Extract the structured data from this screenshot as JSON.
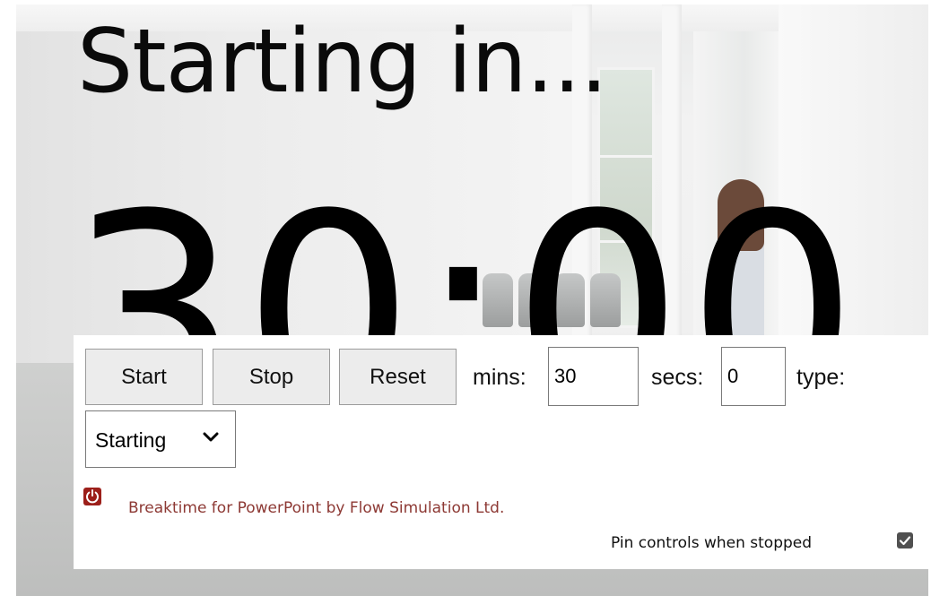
{
  "overlay": {
    "title": "Starting in...",
    "countdown": "30:00"
  },
  "controls": {
    "start_label": "Start",
    "stop_label": "Stop",
    "reset_label": "Reset",
    "mins_label": "mins:",
    "mins_value": "30",
    "secs_label": "secs:",
    "secs_value": "0",
    "type_label": "type:",
    "type_selected": "Starting"
  },
  "footer": {
    "credit_text": "Breaktime for PowerPoint by Flow Simulation Ltd.",
    "pin_label": "Pin controls when stopped",
    "pin_checked": true
  },
  "icons": {
    "logo": "power-icon",
    "dropdown": "chevron-down-icon",
    "check": "checkmark-icon"
  },
  "colors": {
    "credit_text": "#8d3934",
    "logo_bg": "#9c1f1a",
    "button_bg": "#ececec"
  }
}
